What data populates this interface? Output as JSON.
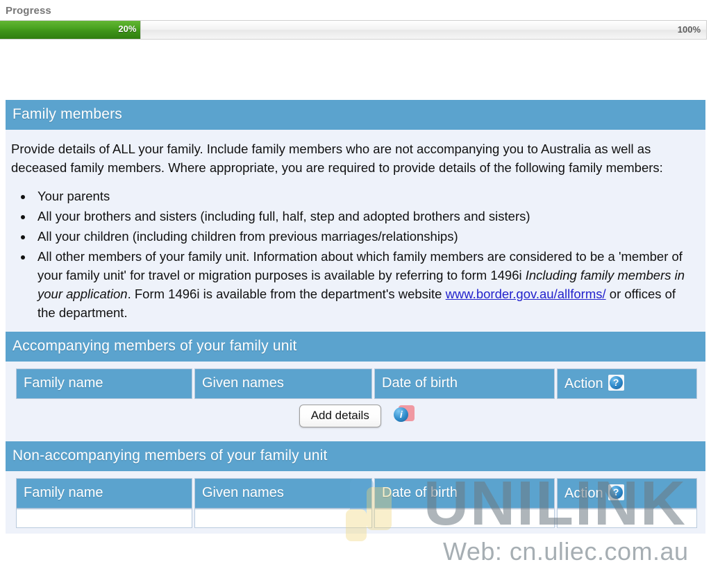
{
  "progress": {
    "label": "Progress",
    "current_value": "20%",
    "max_value": "100%",
    "percent": 20
  },
  "colors": {
    "header_blue": "#5BA3CE",
    "panel_background": "#EEF2FA",
    "progress_green": "#3F9419",
    "link_blue": "#2222CC"
  },
  "form": {
    "section_title": "Family members",
    "intro_paragraph": "Provide details of ALL your family. Include family members who are not accompanying you to Australia as well as deceased family members. Where appropriate, you are required to provide details of the following family members:",
    "bullets": [
      "Your parents",
      "All your brothers and sisters (including full, half, step and adopted brothers and sisters)",
      "All your children (including children from previous marriages/relationships)"
    ],
    "last_bullet": {
      "part1": "All other members of your family unit. Information about which family members are considered to be a 'member of your family unit' for travel or migration purposes is available by referring to form 1496i ",
      "italic": "Including family members in your application",
      "part2": ". Form 1496i is available from the department's website ",
      "link_text": "www.border.gov.au/allforms/",
      "part3": " or offices of the department."
    }
  },
  "accompanying": {
    "section_title": "Accompanying members of your family unit",
    "columns": [
      "Family name",
      "Given names",
      "Date of birth",
      "Action"
    ],
    "action_help_icon": "question-mark-help-icon",
    "rows": [],
    "add_button_label": "Add details",
    "add_info_icon": "info-icon"
  },
  "non_accompanying": {
    "section_title": "Non-accompanying members of your family unit",
    "columns": [
      "Family name",
      "Given names",
      "Date of birth",
      "Action"
    ],
    "action_help_icon": "question-mark-help-icon",
    "rows": []
  },
  "watermark": {
    "title": "UNILINK",
    "url": "Web: cn.uliec.com.au"
  }
}
